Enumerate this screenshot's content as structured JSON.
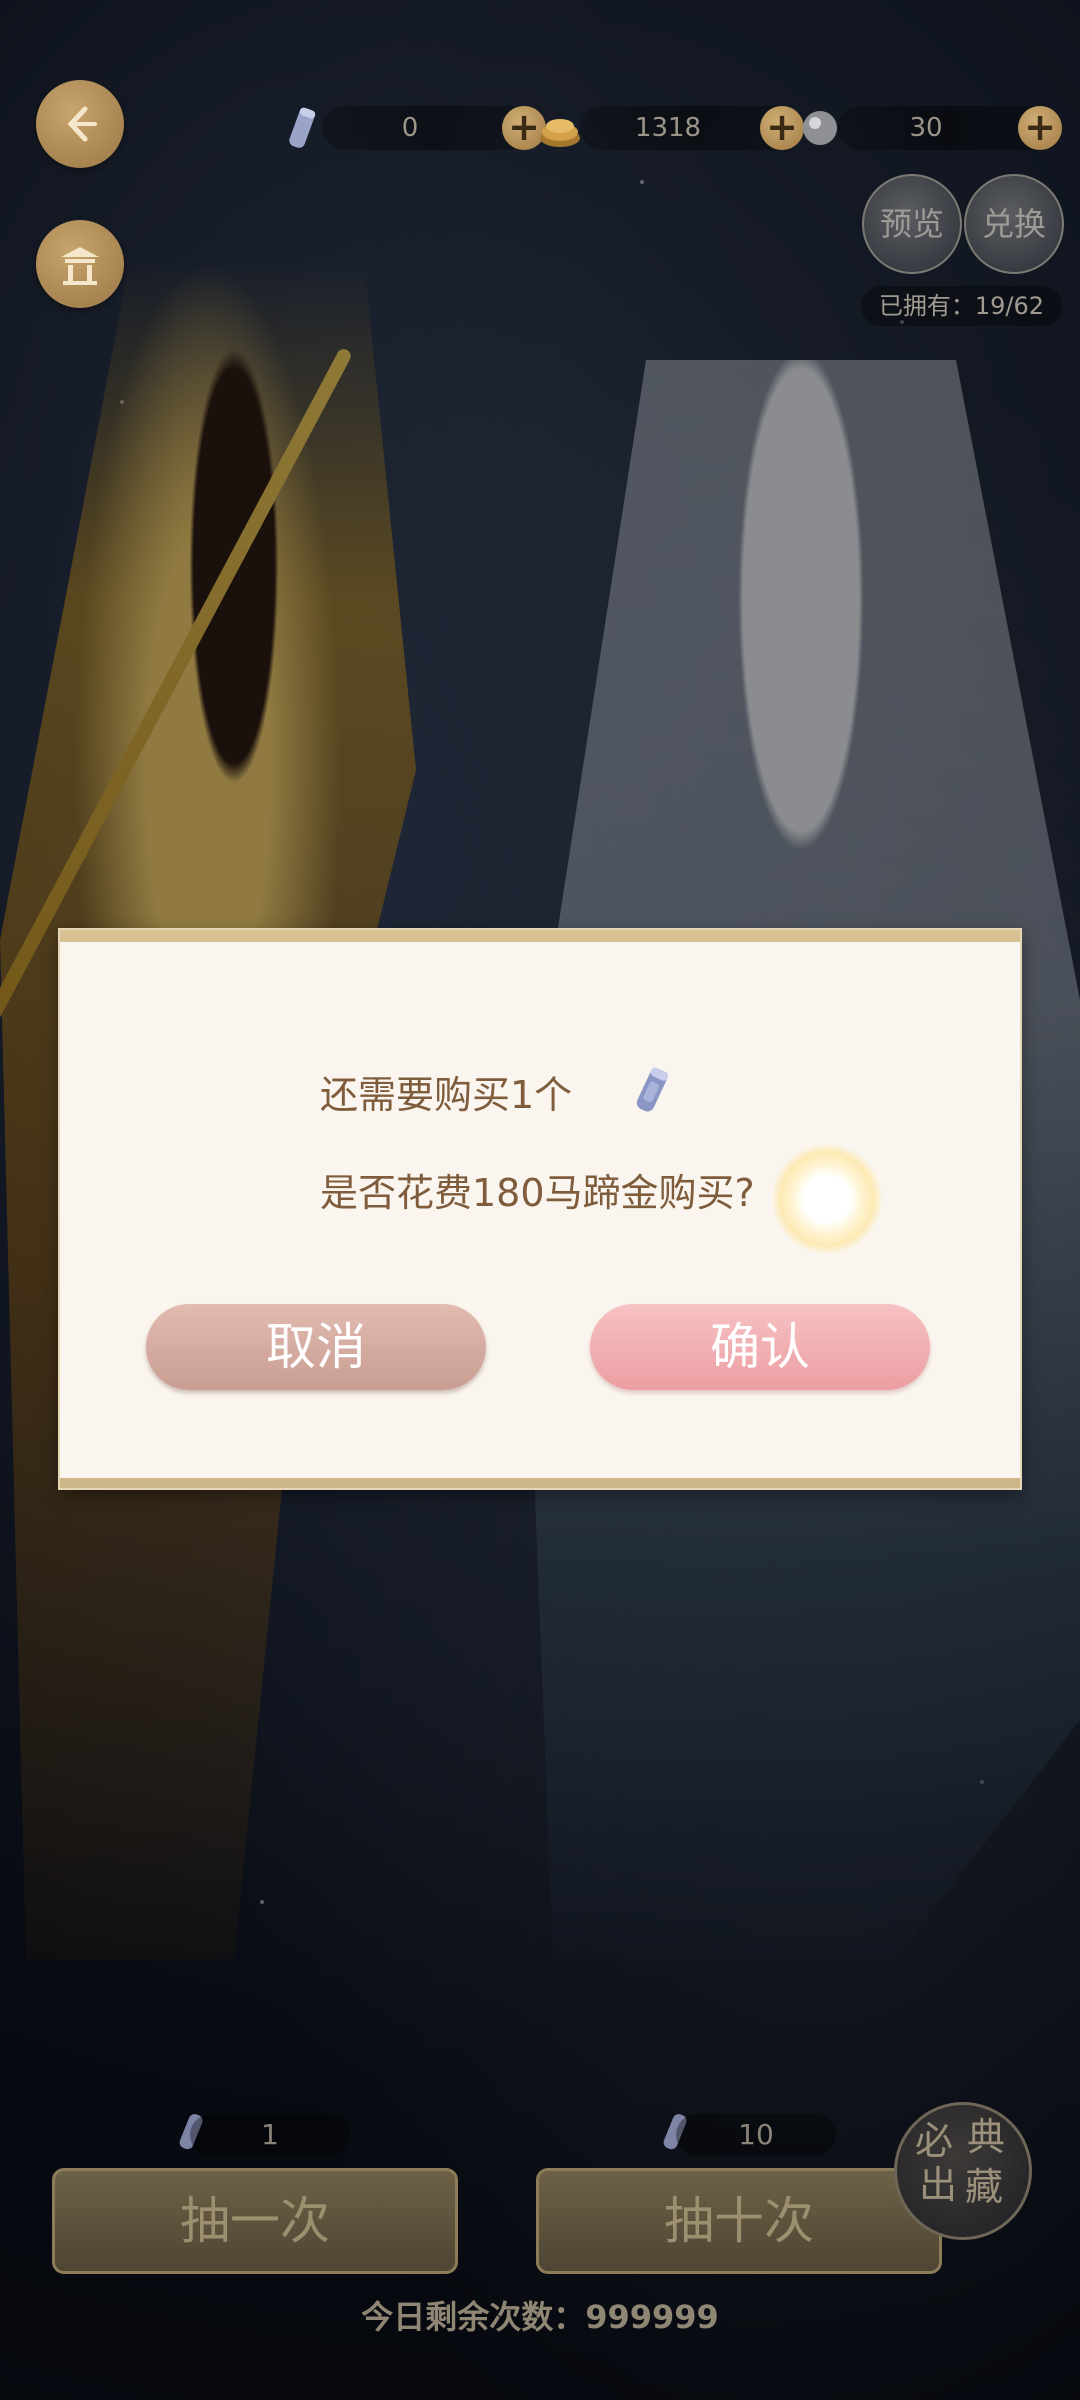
{
  "currencies": [
    {
      "name": "scroll-ticket",
      "value": "0"
    },
    {
      "name": "horseshoe-gold",
      "value": "1318"
    },
    {
      "name": "pearl",
      "value": "30"
    }
  ],
  "top_buttons": {
    "preview": "预览",
    "exchange": "兑换"
  },
  "owned": "已拥有：19/62",
  "dialog": {
    "line1": "还需要购买1个",
    "line2": "是否花费180马蹄金购买?",
    "cancel": "取消",
    "confirm": "确认"
  },
  "draw": {
    "single_cost": "1",
    "ten_cost": "10",
    "single_label": "抽一次",
    "ten_label": "抽十次"
  },
  "seal": {
    "chars": [
      "必",
      "典",
      "出",
      "藏"
    ]
  },
  "daily_remaining": "今日剩余次数：999999",
  "colors": {
    "dialog_bg": "#faf6ef",
    "cancel": "#d8ada3",
    "confirm": "#f2b1b3",
    "dialog_text": "#7e5c3c"
  }
}
